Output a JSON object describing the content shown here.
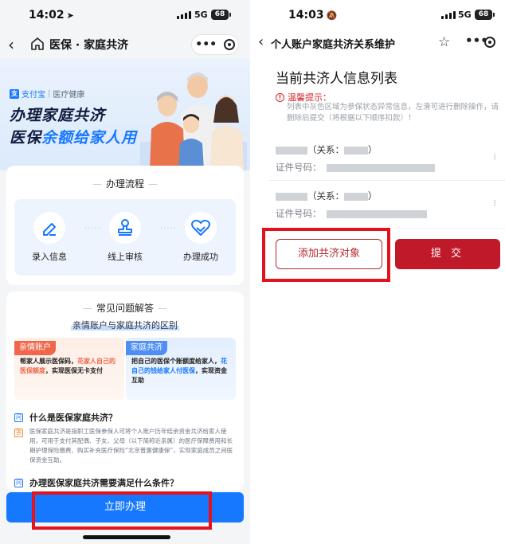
{
  "left": {
    "status": {
      "time": "14:02",
      "network": "5G",
      "battery": "68"
    },
    "nav": {
      "title": "医保 · 家庭共济",
      "more": "•••"
    },
    "banner": {
      "brand": "支付宝",
      "brand_logo": "支",
      "brand_sep": "|",
      "brand_sub": "医疗健康",
      "slogan_line1": "办理家庭共济",
      "slogan_line2_prefix": "医保",
      "slogan_line2_highlight": "余额给家人用"
    },
    "process": {
      "title": "办理流程",
      "steps": [
        {
          "label": "录入信息",
          "icon": "edit-icon"
        },
        {
          "label": "线上审核",
          "icon": "stamp-icon"
        },
        {
          "label": "办理成功",
          "icon": "heart-handshake-icon"
        }
      ]
    },
    "faq": {
      "title": "常见问题解答",
      "subtitle": "亲情账户与家庭共济的区别",
      "card_a": {
        "tag": "亲情账户",
        "text_1": "帮家人展示医保码，",
        "text_em": "花家人自己的医保额度",
        "text_2": "，实现医保无卡支付"
      },
      "card_b": {
        "tag": "家庭共济",
        "text_1": "把自己的医保个账额度给家人，",
        "text_em": "花自己的钱给家人付医保",
        "text_2": "，实现资金互助"
      },
      "q_badge": "问",
      "a_badge": "答",
      "q1": "什么是医保家庭共济？",
      "a1": "医保家庭共济是指职工医保参保人可将个人账户历年结余资金共济给家人使用，可用于支付其配偶、子女、父母（以下简称近亲属）的医疗保障费用和长期护理保险缴费、购买补充医疗保险“北京普惠健康保”，实现家庭成员之间医保资金互助。",
      "q2": "办理医保家庭共济需要满足什么条件？"
    },
    "apply_button": "立即办理"
  },
  "right": {
    "status": {
      "time": "14:03",
      "network": "5G",
      "battery": "68"
    },
    "nav": {
      "title": "个人账户家庭共济关系维护",
      "more": "•••"
    },
    "list_title": "当前共济人信息列表",
    "tip_title": "温馨提示：",
    "tip_body": "列表中灰色区域为参保状态异常信息，左滑可进行删除操作，请删除后提交（将根据以下顺序扣款）！",
    "persons": [
      {
        "relation_prefix": "（关系：",
        "relation_suffix": "）",
        "id_label": "证件号码："
      },
      {
        "relation_prefix": "（关系：",
        "relation_suffix": "）",
        "id_label": "证件号码："
      }
    ],
    "add_button": "添加共济对象",
    "submit_button": "提 交"
  },
  "colors": {
    "alipay_blue": "#1677ff",
    "red_accent": "#c0192a",
    "highlight_box": "#e4121c"
  }
}
